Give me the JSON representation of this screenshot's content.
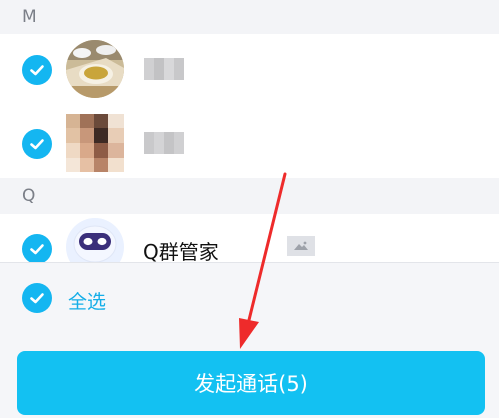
{
  "sections": [
    {
      "label": "M"
    },
    {
      "label": "Q"
    }
  ],
  "contacts": [
    {
      "name": "",
      "checked": true,
      "avatar": "tea-cup-photo",
      "name_hidden": true
    },
    {
      "name": "",
      "checked": true,
      "avatar": "blurred-photo",
      "name_hidden": true
    },
    {
      "name": "Q群管家",
      "checked": true,
      "avatar": "robot-avatar",
      "name_hidden": false,
      "badge_icon": "image-icon"
    }
  ],
  "footer": {
    "select_all_label": "全选",
    "call_button_label": "发起通话(5)"
  },
  "colors": {
    "accent": "#14b6f1",
    "button": "#13c1f2",
    "section_bg": "#f3f4f7",
    "annotation_arrow": "#ee2b2b"
  },
  "icons": [
    "check-icon",
    "image-icon",
    "arrow-annotation"
  ]
}
